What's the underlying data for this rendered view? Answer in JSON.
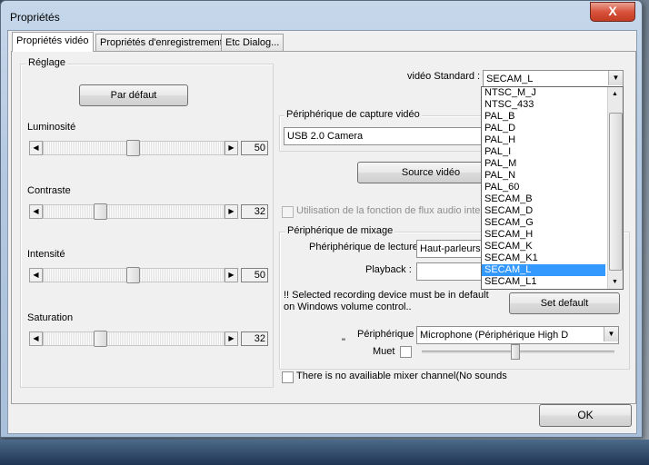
{
  "window": {
    "title": "Propriétés",
    "close_label": "X"
  },
  "tabs": [
    {
      "label": "Propriétés vidéo",
      "active": true
    },
    {
      "label": "Propriétés d'enregistrement",
      "active": false
    },
    {
      "label": "Etc Dialog...",
      "active": false
    }
  ],
  "reglage": {
    "title": "Réglage",
    "default_button": "Par défaut",
    "sliders": [
      {
        "label": "Luminosité",
        "value": "50",
        "level": 0.5
      },
      {
        "label": "Contraste",
        "value": "32",
        "level": 0.32
      },
      {
        "label": "Intensité",
        "value": "50",
        "level": 0.5
      },
      {
        "label": "Saturation",
        "value": "32",
        "level": 0.32
      }
    ]
  },
  "video_standard": {
    "label": "vidéo Standard :",
    "selected": "SECAM_L",
    "options": [
      "NTSC_M_J",
      "NTSC_433",
      "PAL_B",
      "PAL_D",
      "PAL_H",
      "PAL_I",
      "PAL_M",
      "PAL_N",
      "PAL_60",
      "SECAM_B",
      "SECAM_D",
      "SECAM_G",
      "SECAM_H",
      "SECAM_K",
      "SECAM_K1",
      "SECAM_L",
      "SECAM_L1"
    ],
    "highlighted_index": 15
  },
  "capture": {
    "title": "Périphérique de capture vidéo",
    "device": "USB 2.0 Camera",
    "source_button": "Source vidéo",
    "audio_stream_label": "Utilisation de la fonction de flux audio interne"
  },
  "mixage": {
    "title": "Périphérique de mixage",
    "playback_device_label": "Phériphérique de lecture:",
    "playback_device_value": "Haut-parleurs (P",
    "playback_label": "Playback :",
    "playback_value": "",
    "warning": "!! Selected recording device must be in default on Windows volume control..",
    "set_default_button": "Set default",
    "peripherique_label": "Périphérique",
    "quote_mark": "\"",
    "peripherique_value": "Microphone (Périphérique High D",
    "mute_label": "Muet",
    "volume_level": 0.48
  },
  "no_mixer_label": "There is no availiable mixer channel(No sounds",
  "ok_button": "OK",
  "colors": {
    "selection": "#3399ff",
    "close_button": "#c23b22"
  }
}
